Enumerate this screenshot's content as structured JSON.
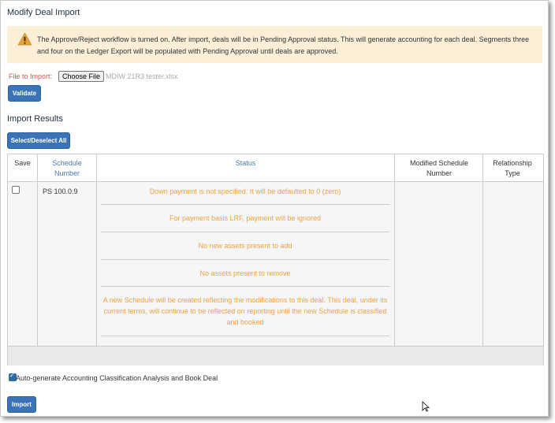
{
  "page": {
    "title": "Modify Deal Import"
  },
  "alert": {
    "icon": "warning-triangle-icon",
    "message": "The Approve/Reject workflow is turned on. After import, deals will be in Pending Approval status. This will generate accounting for each deal. Segments three and four on the Ledger Export will be populated with Pending Approval until deals are approved."
  },
  "file": {
    "label": "File to Import:",
    "button": "Choose File",
    "filename": "MDIW 21R3 tester.xlsx"
  },
  "validate_button": "Validate",
  "results": {
    "title": "Import Results",
    "select_all_button": "Select/Deselect All",
    "columns": [
      "Save",
      "Schedule Number",
      "Status",
      "Modified Schedule Number",
      "Relationship Type"
    ],
    "rows": [
      {
        "save_checked": false,
        "schedule_number": "PS 100.0.9",
        "status": [
          "Down payment is not specified. It will be defaulted to 0 (zero)",
          "For payment basis LRF, payment will be ignored",
          "No new assets present to add",
          "No assets present to remove",
          "A new Schedule will be created reflecting the modifications to this deal. This deal, under its current terms, will continue to be reflected on reporting until the new Schedule is classified and booked"
        ],
        "modified_schedule_number": "",
        "relationship_type": ""
      }
    ]
  },
  "auto_generate": {
    "checked": true,
    "label": "Auto-generate Accounting Classification Analysis and Book Deal"
  },
  "import_button": "Import",
  "colors": {
    "accent": "#3b73b9",
    "warning_bg": "#fcefd8",
    "status_text": "#f0a13c",
    "file_label": "#d9534f"
  }
}
